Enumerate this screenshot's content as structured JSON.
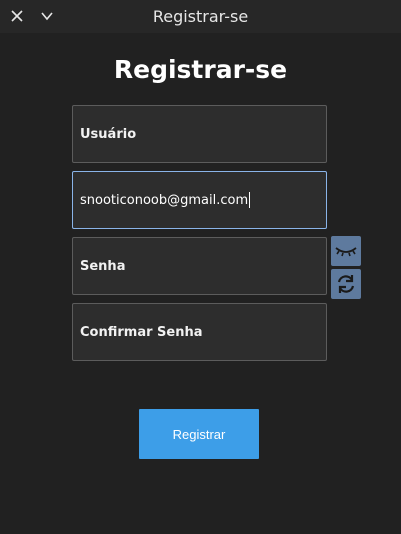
{
  "window": {
    "title": "Registrar-se",
    "close_icon": "close-icon",
    "minimize_icon": "chevron-down-icon"
  },
  "form": {
    "heading": "Registrar-se",
    "username_placeholder": "Usuário",
    "email_value": "snooticonoob@gmail.com",
    "password_placeholder": "Senha",
    "confirm_placeholder": "Confirmar Senha",
    "toggle_visibility_icon": "eye-closed-icon",
    "regenerate_icon": "refresh-icon",
    "submit_label": "Registrar"
  },
  "colors": {
    "background": "#212121",
    "field_background": "#2d2d2d",
    "field_border": "#5c5c5c",
    "focus_border": "#8ab4e8",
    "accent": "#3d9ee8",
    "icon_button": "#5e7a9e"
  }
}
